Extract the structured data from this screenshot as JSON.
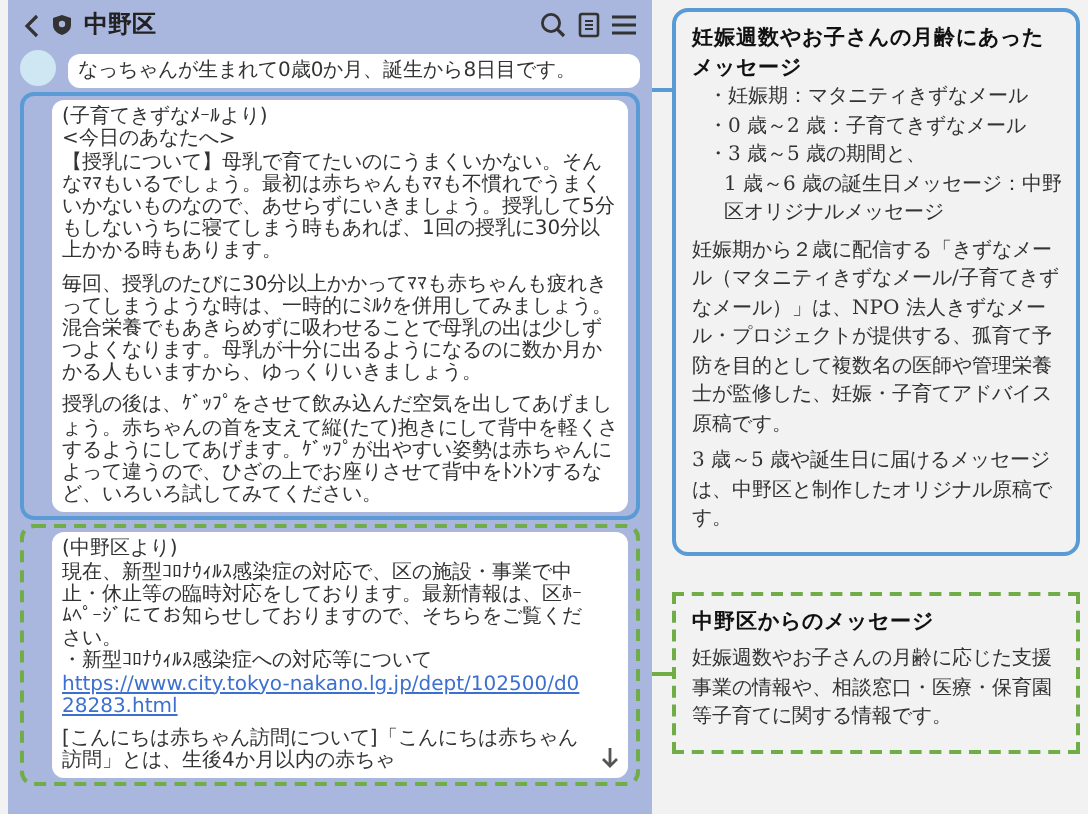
{
  "phone": {
    "title": "中野区",
    "messages": [
      {
        "kind": "plain",
        "paragraphs": [
          [
            {
              "kind": "text",
              "text": "なっちゃんが生まれて0歳0か月、誕生から8日目です。"
            }
          ]
        ]
      },
      {
        "kind": "highlight",
        "paragraphs": [
          [
            {
              "kind": "text",
              "text": "(子育てきずなﾒｰﾙより)"
            },
            {
              "kind": "text",
              "text": "<今日のあなたへ>"
            },
            {
              "kind": "text",
              "text": "【授乳について】母乳で育てたいのにうまくいかない。そんなﾏﾏもいるでしょう。最初は赤ちゃんもﾏﾏも不慣れでうまくいかないものなので、あせらずにいきましょう。授乳して5分もしないうちに寝てしまう時もあれば、1回の授乳に30分以上かかる時もあります。"
            }
          ],
          [
            {
              "kind": "text",
              "text": "毎回、授乳のたびに30分以上かかってﾏﾏも赤ちゃんも疲れきってしまうような時は、一時的にﾐﾙｸを併用してみましょう。混合栄養でもあきらめずに吸わせることで母乳の出は少しずつよくなります。母乳が十分に出るようになるのに数か月かかる人もいますから、ゆっくりいきましょう。"
            }
          ],
          [
            {
              "kind": "text",
              "text": "授乳の後は、ｹﾞｯﾌﾟをさせて飲み込んだ空気を出してあげましょう。赤ちゃんの首を支えて縦(たて)抱きにして背中を軽くさするようにしてあげます。ｹﾞｯﾌﾟが出やすい姿勢は赤ちゃんによって違うので、ひざの上でお座りさせて背中をﾄﾝﾄﾝするなど、いろいろ試してみてください。"
            }
          ]
        ]
      },
      {
        "kind": "notice",
        "paragraphs": [
          [
            {
              "kind": "text",
              "text": "(中野区より)"
            },
            {
              "kind": "text",
              "text": "現在、新型ｺﾛﾅｳｨﾙｽ感染症の対応で、区の施設・事業で中止・休止等の臨時対応をしております。最新情報は、区ﾎｰﾑﾍﾟｰｼﾞにてお知らせしておりますので、そちらをご覧ください。"
            },
            {
              "kind": "text",
              "text": "・新型ｺﾛﾅｳｨﾙｽ感染症への対応等について"
            },
            {
              "kind": "link",
              "text": "https://www.city.tokyo-nakano.lg.jp/dept/102500/d028283.html"
            }
          ],
          [
            {
              "kind": "text",
              "text": "[こんにちは赤ちゃん訪問について]「こんにちは赤ちゃん訪問」とは、生後4か月以内の赤ちゃ"
            }
          ]
        ]
      }
    ]
  },
  "callouts": [
    {
      "kind": "highlight",
      "title": "妊娠週数やお子さんの月齢にあったメッセージ",
      "bullets": [
        [
          "・妊娠期：マタニティきずなメール"
        ],
        [
          "・0 歳～2 歳：子育てきずなメール"
        ],
        [
          "・3 歳～5 歳の期間と、",
          "1 歳～6 歳の誕生日メッセージ：中野区オリジナルメッセージ"
        ]
      ],
      "paragraphs": [
        "妊娠期から２歳に配信する「きずなメール（マタニティきずなメール/子育てきずなメール）」は、NPO 法人きずなメール・プロジェクトが提供する、孤育て予防を目的として複数名の医師や管理栄養士が監修した、妊娠・子育てアドバイス原稿です。",
        "3 歳～5 歳や誕生日に届けるメッセージは、中野区と制作したオリジナル原稿です。"
      ]
    },
    {
      "kind": "notice",
      "title": "中野区からのメッセージ",
      "paragraphs": [
        "妊娠週数やお子さんの月齢に応じた支援事業の情報や、相談窓口・医療・保育園等子育てに関する情報です。"
      ]
    }
  ]
}
